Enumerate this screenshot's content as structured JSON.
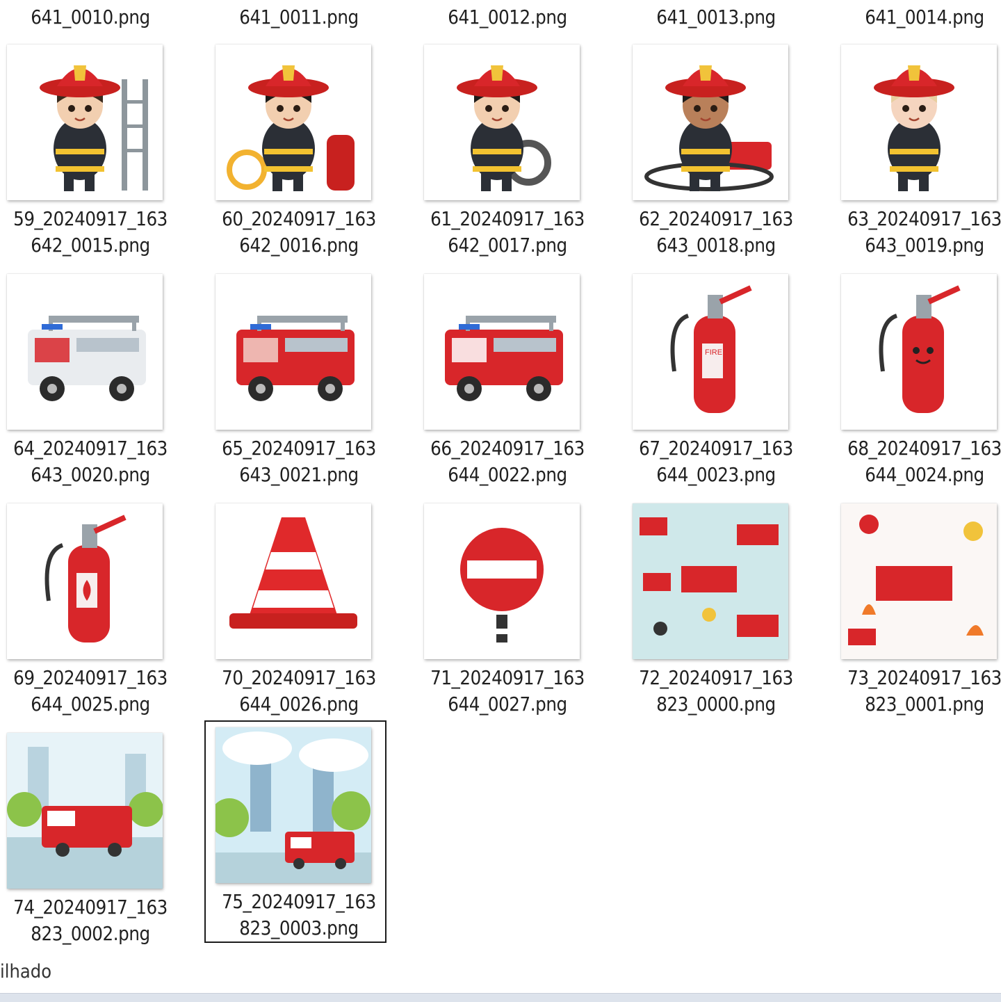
{
  "top_row": [
    {
      "name": "641_0010.png"
    },
    {
      "name": "641_0011.png"
    },
    {
      "name": "641_0012.png"
    },
    {
      "name": "641_0013.png"
    },
    {
      "name": "641_0014.png"
    }
  ],
  "files": [
    {
      "line1": "59_20240917_163",
      "line2": "642_0015.png",
      "icon": "firefighter-ladder"
    },
    {
      "line1": "60_20240917_163",
      "line2": "642_0016.png",
      "icon": "firefighter-hydrant"
    },
    {
      "line1": "61_20240917_163",
      "line2": "642_0017.png",
      "icon": "firefighter-hose"
    },
    {
      "line1": "62_20240917_163",
      "line2": "643_0018.png",
      "icon": "firefighter-truck"
    },
    {
      "line1": "63_20240917_163",
      "line2": "643_0019.png",
      "icon": "firefighter-blond"
    },
    {
      "line1": "64_20240917_163",
      "line2": "643_0020.png",
      "icon": "fire-truck-white"
    },
    {
      "line1": "65_20240917_163",
      "line2": "643_0021.png",
      "icon": "fire-truck-red"
    },
    {
      "line1": "66_20240917_163",
      "line2": "644_0022.png",
      "icon": "fire-truck-ladder"
    },
    {
      "line1": "67_20240917_163",
      "line2": "644_0023.png",
      "icon": "fire-extinguisher"
    },
    {
      "line1": "68_20240917_163",
      "line2": "644_0024.png",
      "icon": "extinguisher-face"
    },
    {
      "line1": "69_20240917_163",
      "line2": "644_0025.png",
      "icon": "fire-extinguisher-flame"
    },
    {
      "line1": "70_20240917_163",
      "line2": "644_0026.png",
      "icon": "traffic-cone"
    },
    {
      "line1": "71_20240917_163",
      "line2": "644_0027.png",
      "icon": "no-entry-sign"
    },
    {
      "line1": "72_20240917_163",
      "line2": "823_0000.png",
      "icon": "pattern-blue"
    },
    {
      "line1": "73_20240917_163",
      "line2": "823_0001.png",
      "icon": "pattern-white"
    },
    {
      "line1": "74_20240917_163",
      "line2": "823_0002.png",
      "icon": "city-street-truck"
    },
    {
      "line1": "75_20240917_163",
      "line2": "823_0003.png",
      "icon": "city-skyline-truck",
      "selected": true
    }
  ],
  "status": {
    "text": "ilhado"
  },
  "colors": {
    "selection_border": "#1c1c1c",
    "fire_red": "#d8262a"
  }
}
